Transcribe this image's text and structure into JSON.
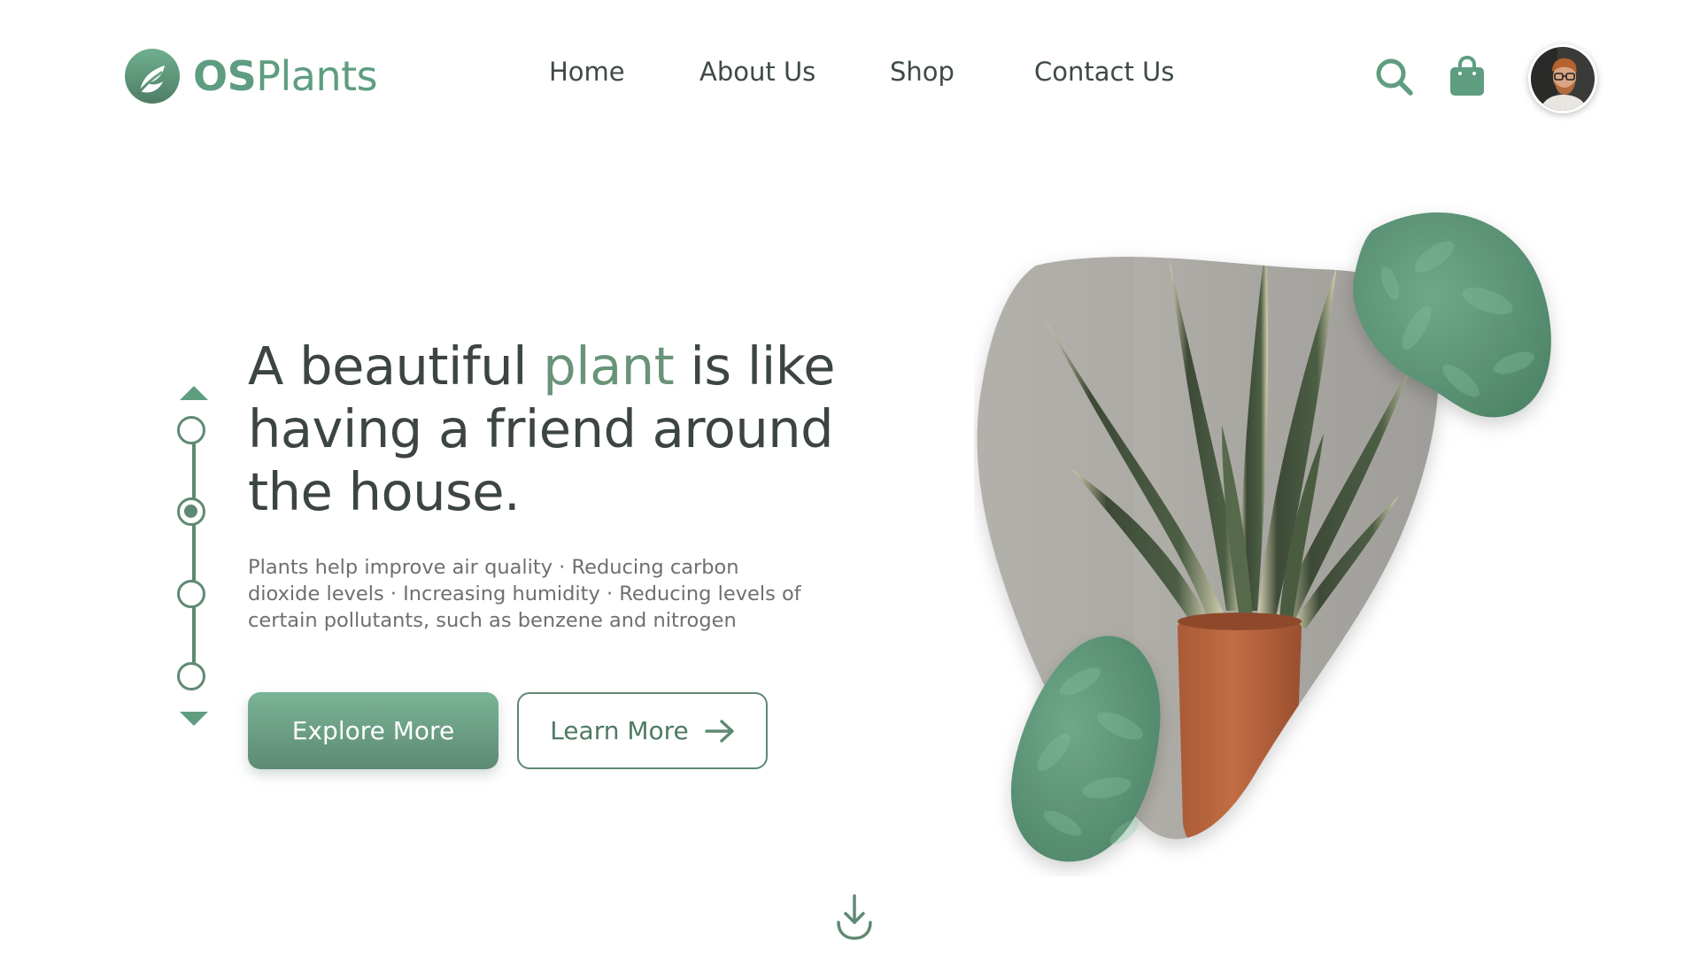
{
  "brand": {
    "name_bold": "OS",
    "name_regular": "Plants",
    "logo_icon": "leaf-logo-icon"
  },
  "nav": {
    "items": [
      {
        "label": "Home"
      },
      {
        "label": "About Us"
      },
      {
        "label": "Shop"
      },
      {
        "label": "Contact Us"
      }
    ]
  },
  "header_actions": {
    "search_icon": "search-icon",
    "cart_icon": "shopping-bag-icon",
    "avatar": "user-avatar"
  },
  "hero": {
    "title_part1": "A beautiful ",
    "title_accent": "plant",
    "title_part2": " is like having a friend around the house.",
    "description": "Plants help improve air quality · Reducing carbon dioxide levels · Increasing humidity · Reducing levels of certain pollutants, such as benzene and nitrogen",
    "explore_label": "Explore More",
    "learn_label": "Learn More"
  },
  "slider": {
    "slide_count": 4,
    "active_index": 2
  },
  "colors": {
    "brand_green": "#5f9d80",
    "dark_green": "#5f8a72",
    "accent_text": "#6a9479",
    "heading": "#3c4540",
    "body_text": "#6f6f6f",
    "pot": "#b8643d"
  }
}
